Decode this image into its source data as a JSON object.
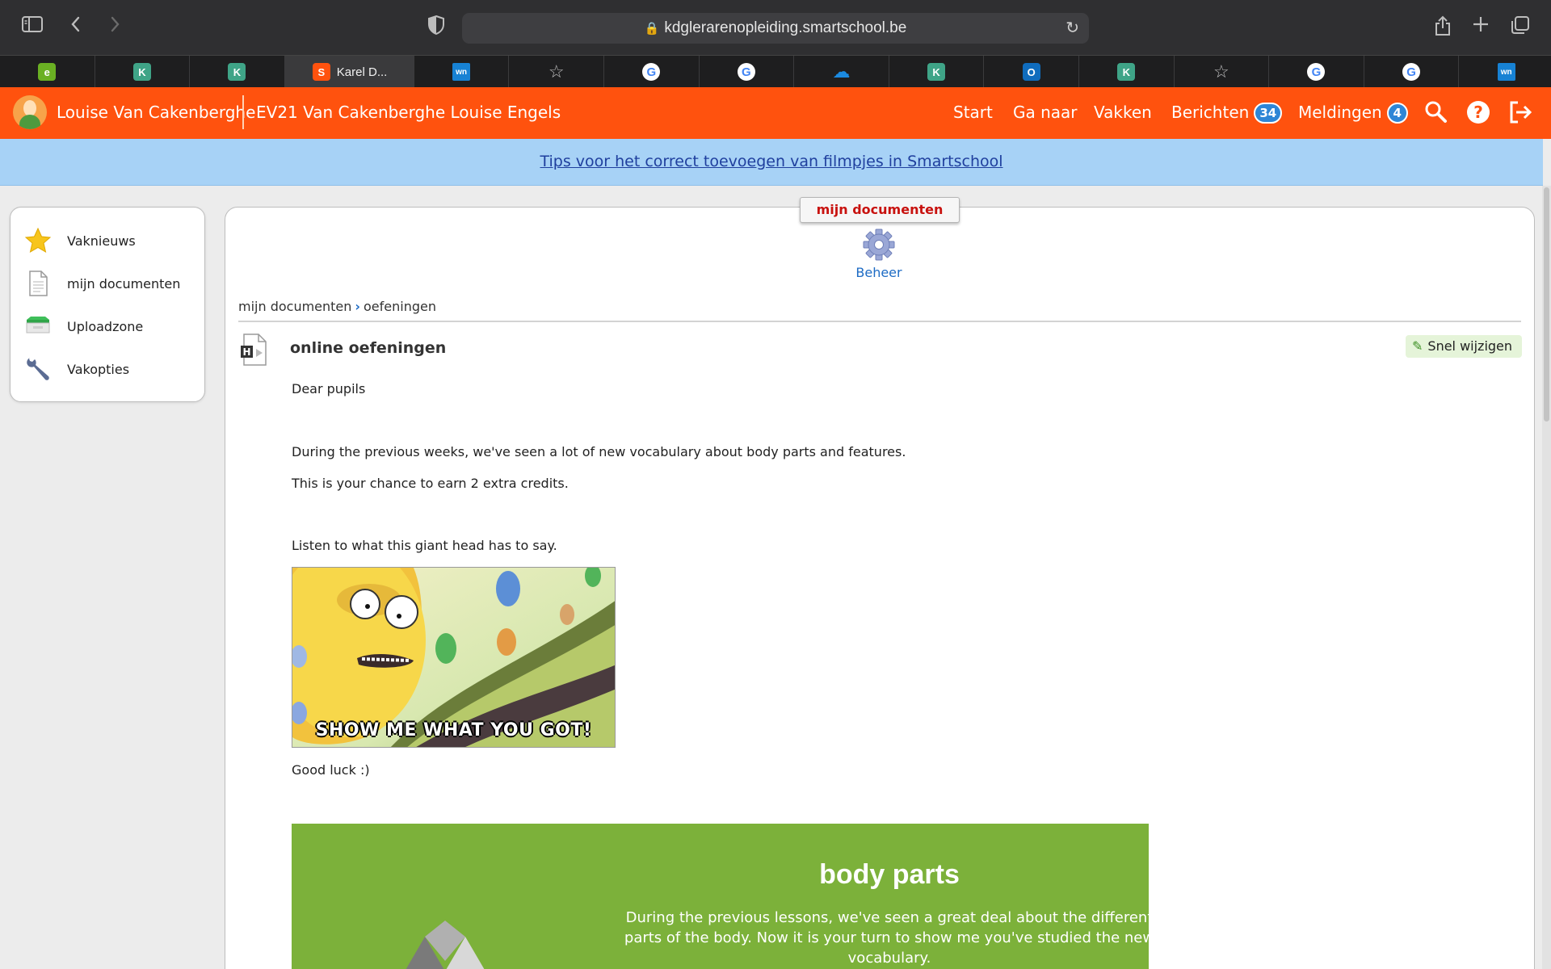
{
  "browser": {
    "url": "kdglerarenopleiding.smartschool.be",
    "tabs": [
      {
        "icon": "e-icon",
        "label": "",
        "bg": "#6ab023",
        "fg": "#ffffff",
        "glyph": "e"
      },
      {
        "icon": "k-icon",
        "label": "",
        "bg": "#3fa487",
        "fg": "#ffffff",
        "glyph": "K"
      },
      {
        "icon": "k-icon",
        "label": "",
        "bg": "#3fa487",
        "fg": "#ffffff",
        "glyph": "K"
      },
      {
        "icon": "smartschool-icon",
        "label": "Karel D...",
        "bg": "#ff520e",
        "fg": "#ffffff",
        "glyph": "S"
      },
      {
        "icon": "wn-icon",
        "label": "",
        "bg": "#1782d4",
        "fg": "#ffffff",
        "glyph": "wn"
      },
      {
        "icon": "star-icon",
        "label": "",
        "bg": "transparent",
        "fg": "#bdbdbd",
        "glyph": "☆"
      },
      {
        "icon": "google-icon",
        "label": "",
        "bg": "#ffffff",
        "fg": "#4285f4",
        "glyph": "G"
      },
      {
        "icon": "google-icon",
        "label": "",
        "bg": "#ffffff",
        "fg": "#4285f4",
        "glyph": "G"
      },
      {
        "icon": "onedrive-icon",
        "label": "",
        "bg": "transparent",
        "fg": "#1b8ae0",
        "glyph": "☁"
      },
      {
        "icon": "k-icon",
        "label": "",
        "bg": "#3fa487",
        "fg": "#ffffff",
        "glyph": "K"
      },
      {
        "icon": "outlook-icon",
        "label": "",
        "bg": "#0f6cbd",
        "fg": "#ffffff",
        "glyph": "O"
      },
      {
        "icon": "k-icon",
        "label": "",
        "bg": "#3fa487",
        "fg": "#ffffff",
        "glyph": "K"
      },
      {
        "icon": "star-icon",
        "label": "",
        "bg": "transparent",
        "fg": "#bdbdbd",
        "glyph": "☆"
      },
      {
        "icon": "google-icon",
        "label": "",
        "bg": "#ffffff",
        "fg": "#4285f4",
        "glyph": "G"
      },
      {
        "icon": "google-icon",
        "label": "",
        "bg": "#ffffff",
        "fg": "#4285f4",
        "glyph": "G"
      },
      {
        "icon": "wn-icon",
        "label": "",
        "bg": "#1782d4",
        "fg": "#ffffff",
        "glyph": "wn"
      }
    ]
  },
  "header": {
    "user": "Louise Van Cakenberghe",
    "course": "EV21 Van Cakenberghe Louise Engels",
    "nav": {
      "start": "Start",
      "ga_naar": "Ga naar",
      "vakken": "Vakken",
      "berichten": "Berichten",
      "berichten_count": "34",
      "meldingen": "Meldingen",
      "meldingen_count": "4"
    },
    "accent": "#ff520e"
  },
  "banner": {
    "link": "Tips voor het correct toevoegen van filmpjes in Smartschool"
  },
  "sidebar": {
    "items": [
      {
        "label": "Vaknieuws",
        "icon": "star-icon"
      },
      {
        "label": "mijn documenten",
        "icon": "document-icon"
      },
      {
        "label": "Uploadzone",
        "icon": "inbox-icon"
      },
      {
        "label": "Vakopties",
        "icon": "wrench-icon"
      }
    ]
  },
  "main": {
    "tab_title": "mijn documenten",
    "beheer": "Beheer",
    "breadcrumb": [
      "mijn documenten",
      "oefeningen"
    ],
    "doc_title": "online oefeningen",
    "snel_wijzigen": "Snel wijzigen",
    "paragraphs": {
      "greeting": "Dear pupils",
      "p1": "During the previous weeks, we've seen a lot of new vocabulary about body parts and features.",
      "p2": "This is your chance to earn 2 extra credits.",
      "p3": "Listen to what this giant head has to say.",
      "p4": "Good luck :)"
    },
    "gif_caption": "SHOW ME WHAT YOU GOT!",
    "card": {
      "title": "body parts",
      "text": "During the previous lessons, we've seen a great deal about the different parts of the body. Now it is your turn to show me you've studied the new vocabulary."
    }
  }
}
